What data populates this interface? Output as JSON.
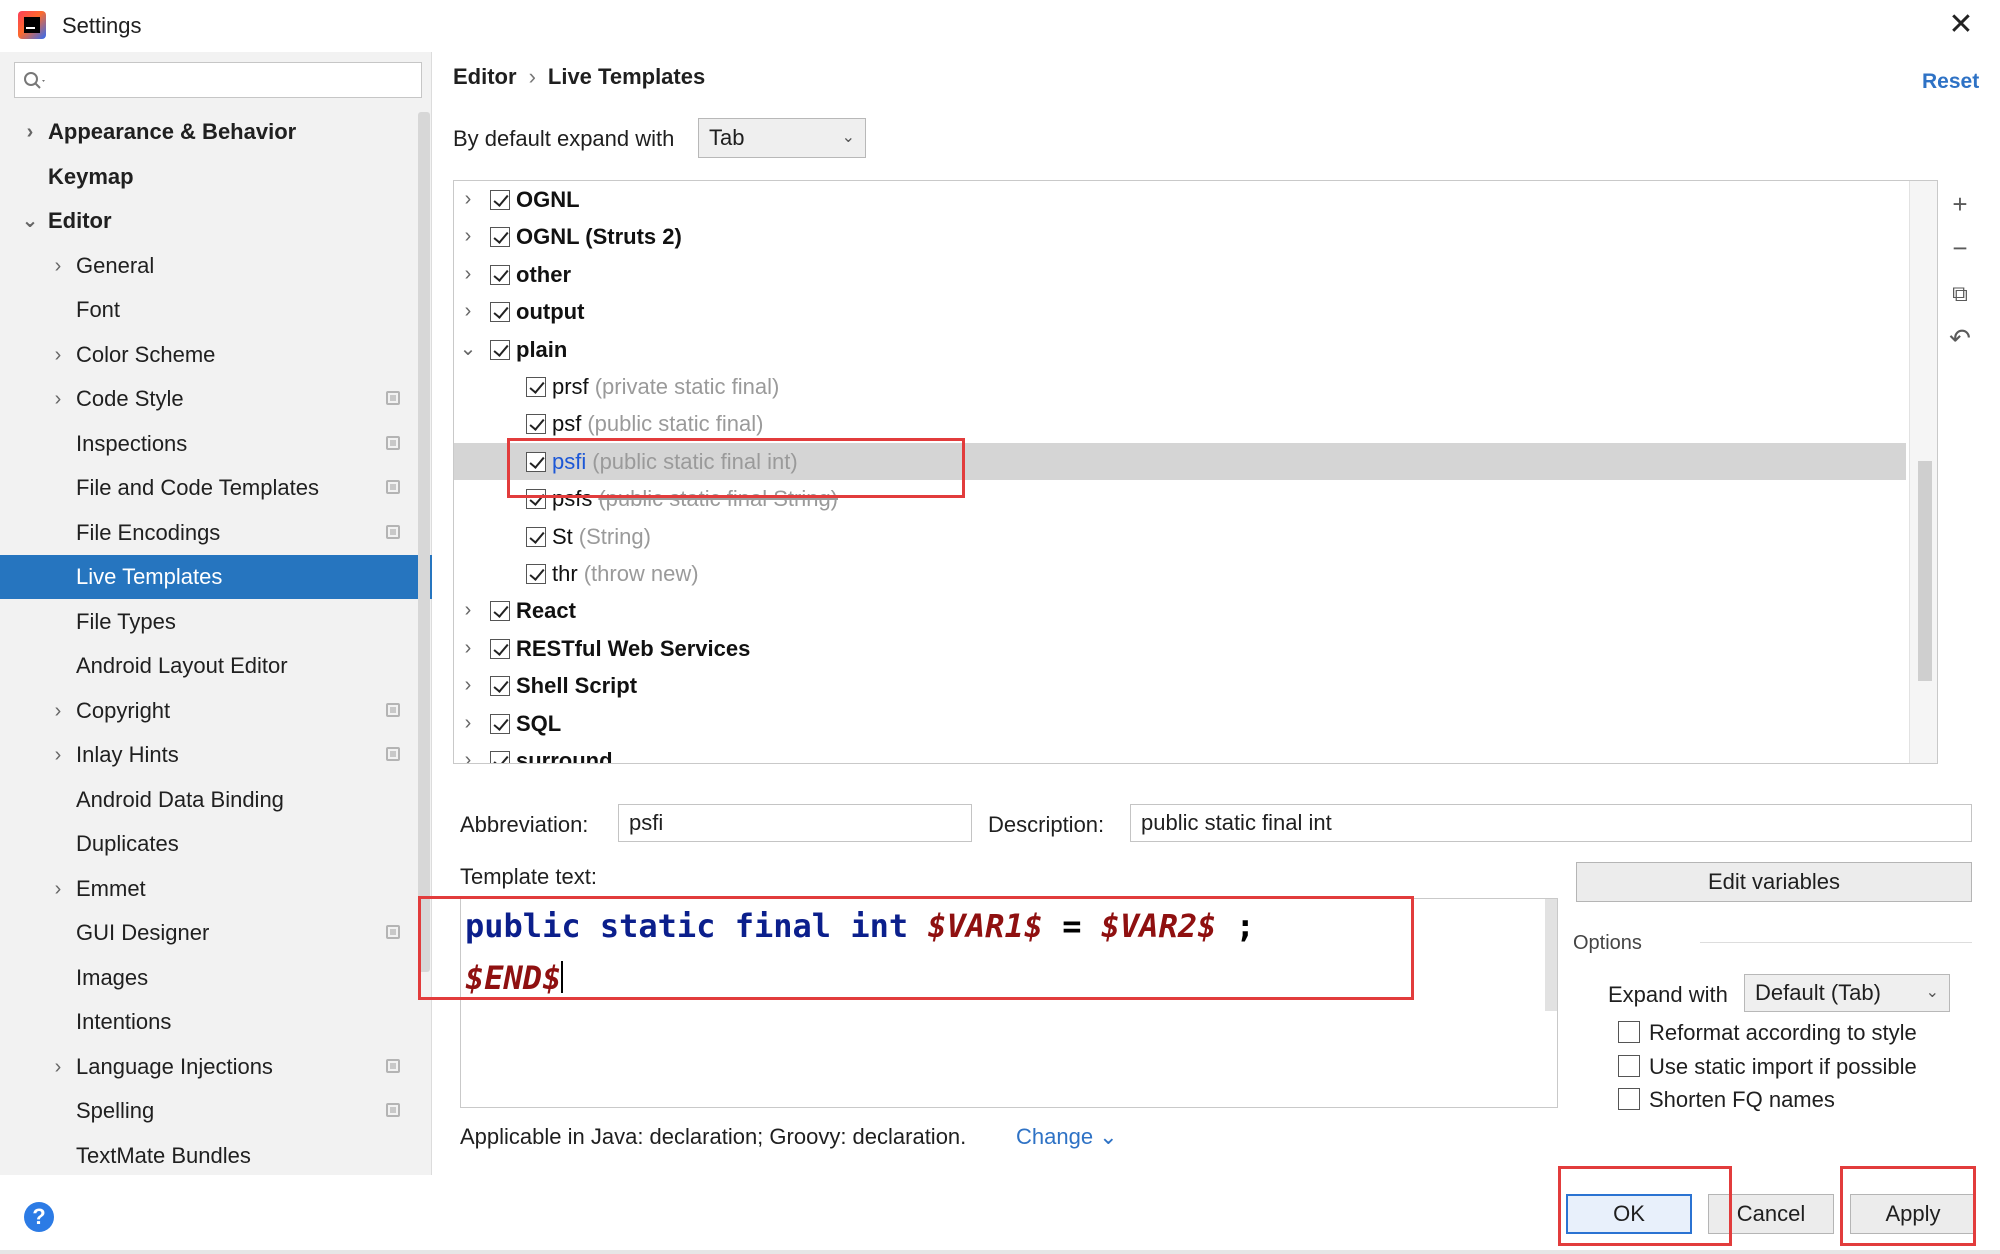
{
  "window": {
    "title": "Settings"
  },
  "sidebar": {
    "search_placeholder": "",
    "items": [
      {
        "label": "Appearance & Behavior",
        "chevron": "›",
        "bold": true
      },
      {
        "label": "Keymap",
        "bold": true
      },
      {
        "label": "Editor",
        "chevron": "⌄",
        "bold": true,
        "expanded": true
      },
      {
        "label": "General",
        "chevron": "›"
      },
      {
        "label": "Font"
      },
      {
        "label": "Color Scheme",
        "chevron": "›"
      },
      {
        "label": "Code Style",
        "chevron": "›",
        "project_icon": true
      },
      {
        "label": "Inspections",
        "project_icon": true
      },
      {
        "label": "File and Code Templates",
        "project_icon": true
      },
      {
        "label": "File Encodings",
        "project_icon": true
      },
      {
        "label": "Live Templates",
        "selected": true
      },
      {
        "label": "File Types"
      },
      {
        "label": "Android Layout Editor"
      },
      {
        "label": "Copyright",
        "chevron": "›",
        "project_icon": true
      },
      {
        "label": "Inlay Hints",
        "chevron": "›",
        "project_icon": true
      },
      {
        "label": "Android Data Binding"
      },
      {
        "label": "Duplicates"
      },
      {
        "label": "Emmet",
        "chevron": "›"
      },
      {
        "label": "GUI Designer",
        "project_icon": true
      },
      {
        "label": "Images"
      },
      {
        "label": "Intentions"
      },
      {
        "label": "Language Injections",
        "chevron": "›",
        "project_icon": true
      },
      {
        "label": "Spelling",
        "project_icon": true
      },
      {
        "label": "TextMate Bundles"
      }
    ]
  },
  "header": {
    "breadcrumb": [
      "Editor",
      "Live Templates"
    ],
    "breadcrumb_sep": "›",
    "reset": "Reset"
  },
  "expand": {
    "label": "By default expand with",
    "value": "Tab"
  },
  "templates": [
    {
      "name": "OGNL",
      "group": true,
      "checked": true,
      "chevron": "›"
    },
    {
      "name": "OGNL (Struts 2)",
      "group": true,
      "checked": true,
      "chevron": "›"
    },
    {
      "name": "other",
      "group": true,
      "checked": true,
      "chevron": "›"
    },
    {
      "name": "output",
      "group": true,
      "checked": true,
      "chevron": "›"
    },
    {
      "name": "plain",
      "group": true,
      "checked": true,
      "chevron": "⌄"
    },
    {
      "name": "prsf",
      "desc": "(private static final)",
      "checked": true
    },
    {
      "name": "psf",
      "desc": "(public static final)",
      "checked": true
    },
    {
      "name": "psfi",
      "desc": "(public static final int)",
      "checked": true,
      "selected": true
    },
    {
      "name": "psfs",
      "desc": "(public static final String)",
      "checked": true,
      "strike": true
    },
    {
      "name": "St",
      "desc": "(String)",
      "checked": true
    },
    {
      "name": "thr",
      "desc": "(throw new)",
      "checked": true
    },
    {
      "name": "React",
      "group": true,
      "checked": true,
      "chevron": "›"
    },
    {
      "name": "RESTful Web Services",
      "group": true,
      "checked": true,
      "chevron": "›"
    },
    {
      "name": "Shell Script",
      "group": true,
      "checked": true,
      "chevron": "›"
    },
    {
      "name": "SQL",
      "group": true,
      "checked": true,
      "chevron": "›"
    },
    {
      "name": "surround",
      "group": true,
      "checked": true,
      "chevron": "›"
    }
  ],
  "toolbar": {
    "add": "+",
    "remove": "−",
    "copy": "⧉",
    "restore": "↶"
  },
  "details": {
    "abbreviation_label": "Abbreviation:",
    "abbreviation": "psfi",
    "description_label": "Description:",
    "description": "public static final int",
    "template_text_label": "Template text:",
    "edit_variables": "Edit variables",
    "code": {
      "kw1": "public",
      "kw2": "static",
      "kw3": "final",
      "kw4": "int",
      "var1": "$VAR1$",
      "eq": "=",
      "var2": "$VAR2$",
      "semi": ";",
      "end": "$END$"
    }
  },
  "options": {
    "title": "Options",
    "expand_label": "Expand with",
    "expand_value": "Default (Tab)",
    "reformat": "Reformat according to style",
    "static_import": "Use static import if possible",
    "shorten_fq": "Shorten FQ names"
  },
  "applicable": {
    "text": "Applicable in Java: declaration; Groovy: declaration.",
    "change": "Change ⌄"
  },
  "footer": {
    "ok": "OK",
    "cancel": "Cancel",
    "apply": "Apply",
    "help": "?"
  },
  "colors": {
    "accent": "#2675bf",
    "highlight_box": "#e23c3c",
    "keyword": "#0b1f8c",
    "variable": "#8f1010"
  }
}
